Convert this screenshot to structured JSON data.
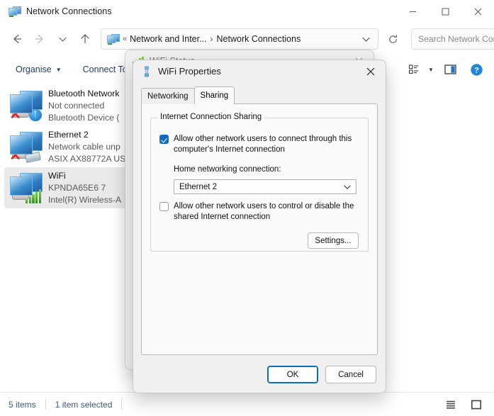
{
  "window": {
    "title": "Network Connections",
    "title_icon": "network-connections-icon",
    "minimize_label": "Minimize",
    "maximize_label": "Maximize",
    "close_label": "Close"
  },
  "nav": {
    "back_label": "Back",
    "forward_label": "Forward",
    "recent_label": "Recent locations",
    "up_label": "Up",
    "refresh_label": "Refresh"
  },
  "address": {
    "icon": "network-connections-icon",
    "overflow": "«",
    "crumbs": [
      "Network and Inter...",
      "Network Connections"
    ],
    "separator": "›",
    "dropdown_label": "Previous locations"
  },
  "search": {
    "placeholder": "Search Network Con...",
    "icon": "search-icon"
  },
  "commandbar": {
    "organise": "Organise",
    "connect_to": "Connect To",
    "view_options_label": "View options",
    "preview_pane_label": "Preview pane",
    "help_label": "Help"
  },
  "filelist": {
    "items": [
      {
        "name": "Bluetooth Network",
        "status": "Not connected",
        "device": "Bluetooth Device (",
        "icon": "bluetooth-adapter-icon",
        "selected": false,
        "disabled": true
      },
      {
        "name": "Ethernet 2",
        "status": "Network cable unp",
        "device": "ASIX AX88772A US",
        "icon": "ethernet-adapter-icon",
        "selected": false,
        "disabled": true
      },
      {
        "name": "WiFi",
        "status": "KPNDA65E6 7",
        "device": "Intel(R) Wireless-A",
        "icon": "wifi-adapter-icon",
        "selected": true,
        "disabled": false
      }
    ]
  },
  "statusbar": {
    "item_count": "5 items",
    "selection": "1 item selected",
    "list_view_label": "List view",
    "details_view_label": "Details view"
  },
  "status_dialog": {
    "title": "WiFi Status",
    "icon": "wifi-signal-icon",
    "close_label": "Close"
  },
  "properties_dialog": {
    "title": "WiFi Properties",
    "icon": "network-adapter-icon",
    "close_label": "Close",
    "tabs": [
      {
        "label": "Networking",
        "active": false
      },
      {
        "label": "Sharing",
        "active": true
      }
    ],
    "group": {
      "legend": "Internet Connection Sharing",
      "allow_connect": {
        "label": "Allow other network users to connect through this computer's Internet connection",
        "checked": true
      },
      "home_networking_label": "Home networking connection:",
      "home_networking_value": "Ethernet 2",
      "allow_control": {
        "label": "Allow other network users to control or disable the shared Internet connection",
        "checked": false
      },
      "settings_button": "Settings..."
    },
    "ok_button": "OK",
    "cancel_button": "Cancel"
  },
  "colors": {
    "accent": "#0f6cbd",
    "link": "#1b3f6b",
    "selection": "#e9e9e9",
    "status_text": "#3b5b86"
  }
}
